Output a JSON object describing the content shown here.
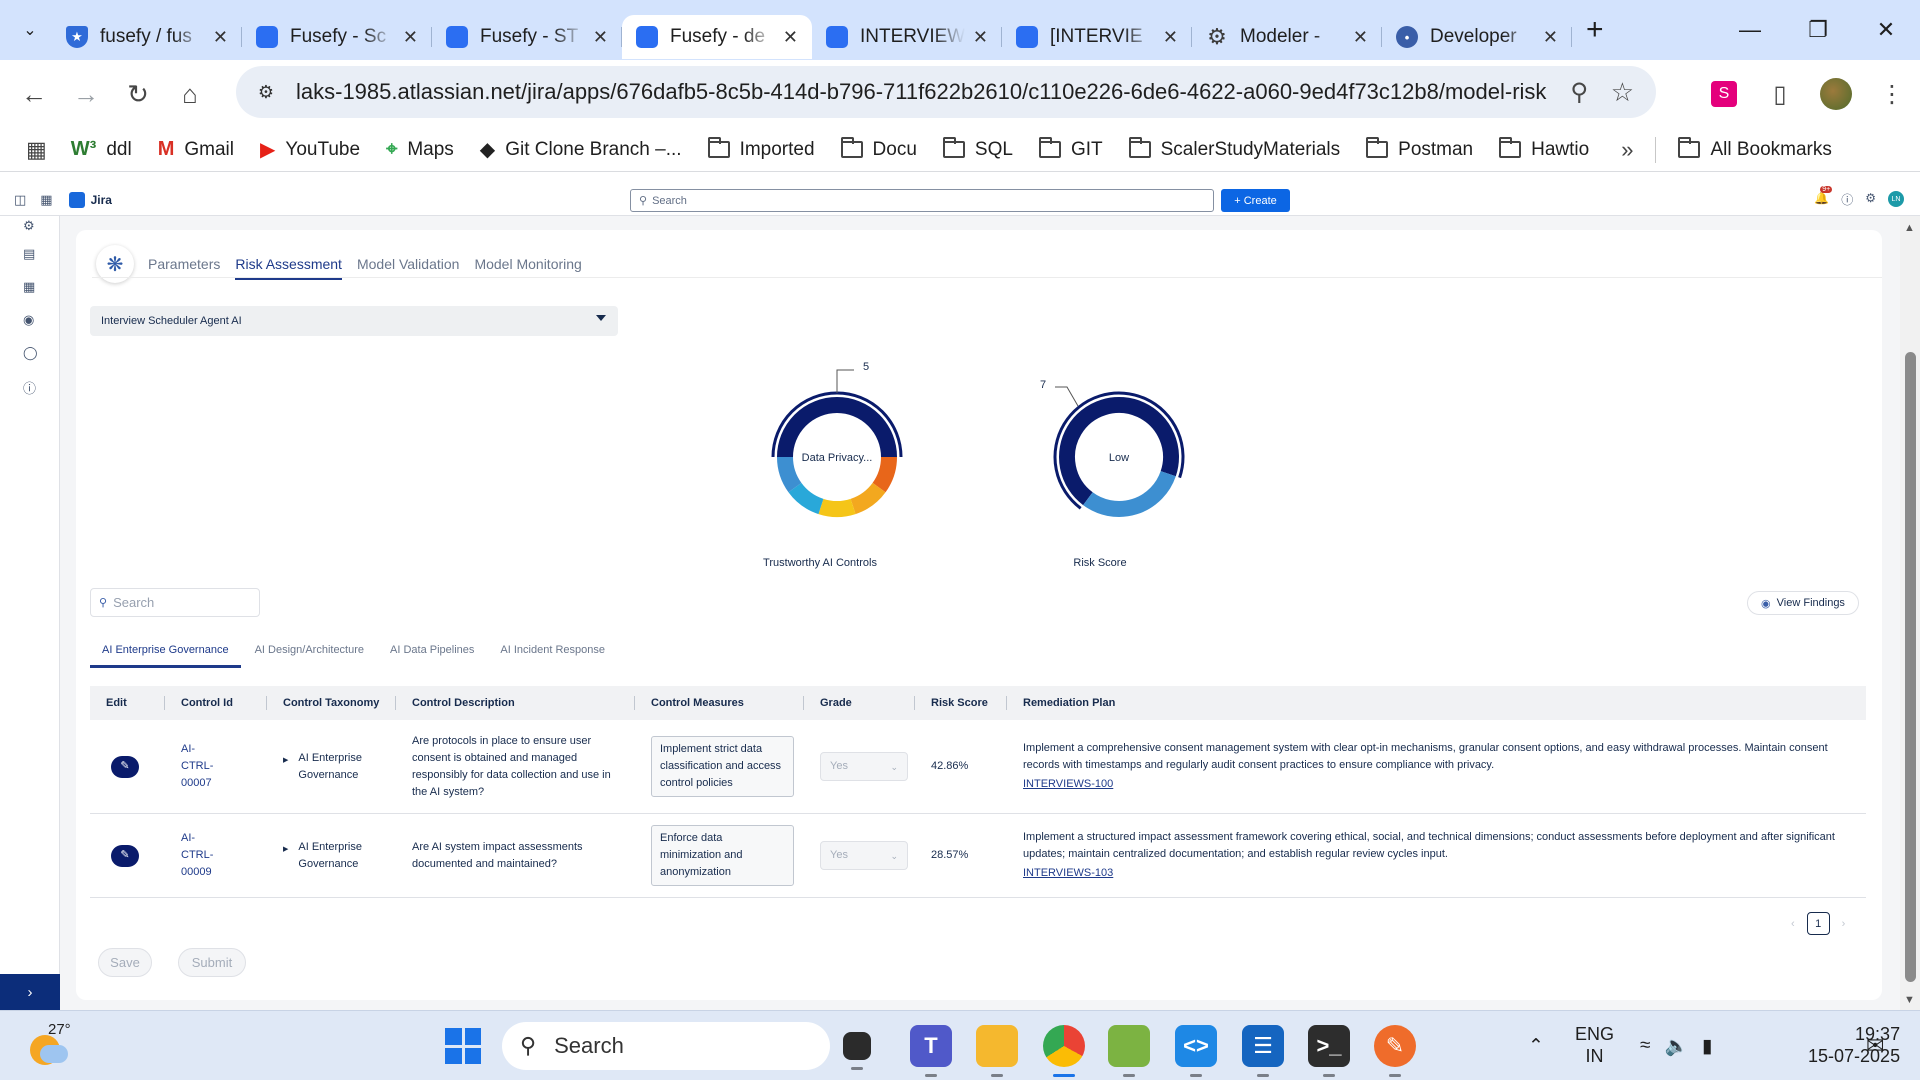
{
  "browser": {
    "tabs": [
      {
        "title": "fusefy / fus",
        "icon": "shield-icon"
      },
      {
        "title": "Fusefy - Sc",
        "icon": "jira-icon"
      },
      {
        "title": "Fusefy - ST",
        "icon": "jira-icon"
      },
      {
        "title": "Fusefy - de",
        "icon": "jira-icon",
        "active": true
      },
      {
        "title": "INTERVIEW",
        "icon": "jira-icon"
      },
      {
        "title": "[INTERVIE",
        "icon": "jira-icon"
      },
      {
        "title": "Modeler -",
        "icon": "gear-icon"
      },
      {
        "title": "Developer",
        "icon": "droplet-icon"
      }
    ],
    "url": "laks-1985.atlassian.net/jira/apps/676dafb5-8c5b-414d-b796-711f622b2610/c110e226-6de6-4622-a060-9ed4f73c12b8/model-risk",
    "bookmarks": [
      {
        "label": "ddl",
        "icon": "w3-icon"
      },
      {
        "label": "Gmail",
        "icon": "gmail-icon"
      },
      {
        "label": "YouTube",
        "icon": "youtube-icon"
      },
      {
        "label": "Maps",
        "icon": "maps-icon"
      },
      {
        "label": "Git Clone Branch –...",
        "icon": "git-icon"
      },
      {
        "label": "Imported",
        "icon": "folder-icon"
      },
      {
        "label": "Docu",
        "icon": "folder-icon"
      },
      {
        "label": "SQL",
        "icon": "folder-icon"
      },
      {
        "label": "GIT",
        "icon": "folder-icon"
      },
      {
        "label": "ScalerStudyMaterials",
        "icon": "folder-icon"
      },
      {
        "label": "Postman",
        "icon": "folder-icon"
      },
      {
        "label": "Hawtio",
        "icon": "folder-icon"
      }
    ],
    "all_bookmarks": "All Bookmarks"
  },
  "jira": {
    "product": "Jira",
    "search_placeholder": "Search",
    "create_label": "+ Create",
    "avatar_initials": "LN",
    "notification_count": "9+"
  },
  "page": {
    "tabs": [
      "Parameters",
      "Risk Assessment",
      "Model Validation",
      "Model Monitoring"
    ],
    "active_tab": "Risk Assessment",
    "model_selected": "Interview Scheduler Agent AI",
    "donut_controls": {
      "center": "Data Privacy...",
      "label": "Trustworthy AI Controls",
      "callout": "5",
      "segments": [
        {
          "value": 5,
          "color": "#0a1b6b"
        },
        {
          "value": 1,
          "color": "#e8661a"
        },
        {
          "value": 1,
          "color": "#f3a81f"
        },
        {
          "value": 1,
          "color": "#f5c518"
        },
        {
          "value": 1,
          "color": "#29a8d9"
        },
        {
          "value": 1,
          "color": "#3d8fd1"
        }
      ]
    },
    "donut_risk": {
      "center": "Low",
      "label": "Risk Score",
      "callout": "7",
      "segments": [
        {
          "value": 7,
          "color": "#0a1b6b"
        },
        {
          "value": 3,
          "color": "#3d8fd1"
        }
      ]
    },
    "search_placeholder": "Search",
    "view_findings": "View Findings",
    "control_tabs": [
      "AI Enterprise Governance",
      "AI Design/Architecture",
      "AI Data Pipelines",
      "AI Incident Response"
    ],
    "active_control_tab": "AI Enterprise Governance",
    "columns": [
      "Edit",
      "Control Id",
      "Control Taxonomy",
      "Control Description",
      "Control Measures",
      "Grade",
      "Risk Score",
      "Remediation Plan"
    ],
    "rows": [
      {
        "control_id": "AI-CTRL-00007",
        "taxonomy": "AI Enterprise Governance",
        "description": "Are protocols in place to ensure user consent is obtained and managed responsibly for data collection and use in the AI system?",
        "measure": "Implement strict data classification and access control policies",
        "grade": "Yes",
        "risk_score": "42.86%",
        "remediation": "Implement a comprehensive consent management system with clear opt-in mechanisms, granular consent options, and easy withdrawal processes. Maintain consent records with timestamps and regularly audit consent practices to ensure compliance with privacy.",
        "link": "INTERVIEWS-100"
      },
      {
        "control_id": "AI-CTRL-00009",
        "taxonomy": "AI Enterprise Governance",
        "description": "Are AI system impact assessments documented and maintained?",
        "measure": "Enforce data minimization and anonymization",
        "grade": "Yes",
        "risk_score": "28.57%",
        "remediation": "Implement a structured impact assessment framework covering ethical, social, and technical dimensions; conduct assessments before deployment and after significant updates; maintain centralized documentation; and establish regular review cycles input.",
        "link": "INTERVIEWS-103"
      }
    ],
    "page_number": "1",
    "save_label": "Save",
    "submit_label": "Submit"
  },
  "taskbar": {
    "temperature": "27°",
    "search_label": "Search",
    "lang_line1": "ENG",
    "lang_line2": "IN",
    "time": "19:37",
    "date": "15-07-2025"
  }
}
